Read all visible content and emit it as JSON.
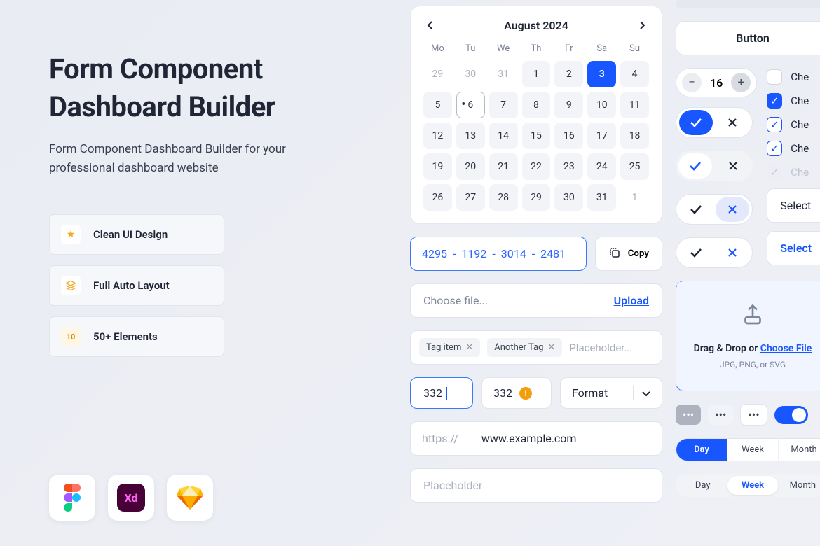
{
  "hero": {
    "title_line1": "Form Component",
    "title_line2": "Dashboard Builder",
    "subtitle": "Form Component Dashboard Builder for your professional dashboard website"
  },
  "features": [
    {
      "label": "Clean UI Design",
      "icon": "star"
    },
    {
      "label": "Full Auto Layout",
      "icon": "layers"
    },
    {
      "label": "50+ Elements",
      "icon": "10"
    }
  ],
  "apps": [
    "figma",
    "xd",
    "sketch"
  ],
  "calendar": {
    "month_label": "August 2024",
    "dow": [
      "Mo",
      "Tu",
      "We",
      "Th",
      "Fr",
      "Sa",
      "Su"
    ],
    "prev_month_days": [
      29,
      30,
      31
    ],
    "range1": [
      1,
      2
    ],
    "selected": 3,
    "after_selected": [
      4
    ],
    "today": 6,
    "before_today": [
      5
    ],
    "rest": [
      7,
      8,
      9,
      10,
      11,
      12,
      13,
      14,
      15,
      16,
      17,
      18,
      19,
      20,
      21,
      22,
      23,
      24,
      25,
      26,
      27,
      28,
      29,
      30,
      31
    ],
    "next_month": [
      1
    ]
  },
  "code": {
    "parts": [
      "4295",
      "1192",
      "3014",
      "2481"
    ],
    "sep": "-",
    "copy_label": "Copy"
  },
  "file": {
    "placeholder": "Choose file...",
    "action": "Upload"
  },
  "tags": {
    "items": [
      "Tag item",
      "Another Tag"
    ],
    "placeholder": "Placeholder..."
  },
  "numbers": {
    "focused": "332",
    "warn": "332",
    "format": "Format"
  },
  "url": {
    "prefix": "https://",
    "value": "www.example.com"
  },
  "placeholder_input": "Placeholder",
  "right": {
    "button_label": "Button",
    "stepper": "16",
    "checks": [
      "Che",
      "Che",
      "Che",
      "Che",
      "Che"
    ],
    "select": "Select",
    "select_blue": "Select",
    "dropzone": {
      "line1_a": "Drag & Drop or ",
      "line1_b": "Choose File",
      "line2": "JPG, PNG, or SVG"
    },
    "seg": [
      "Day",
      "Week",
      "Month"
    ],
    "seg2": [
      "Day",
      "Week",
      "Month"
    ]
  }
}
